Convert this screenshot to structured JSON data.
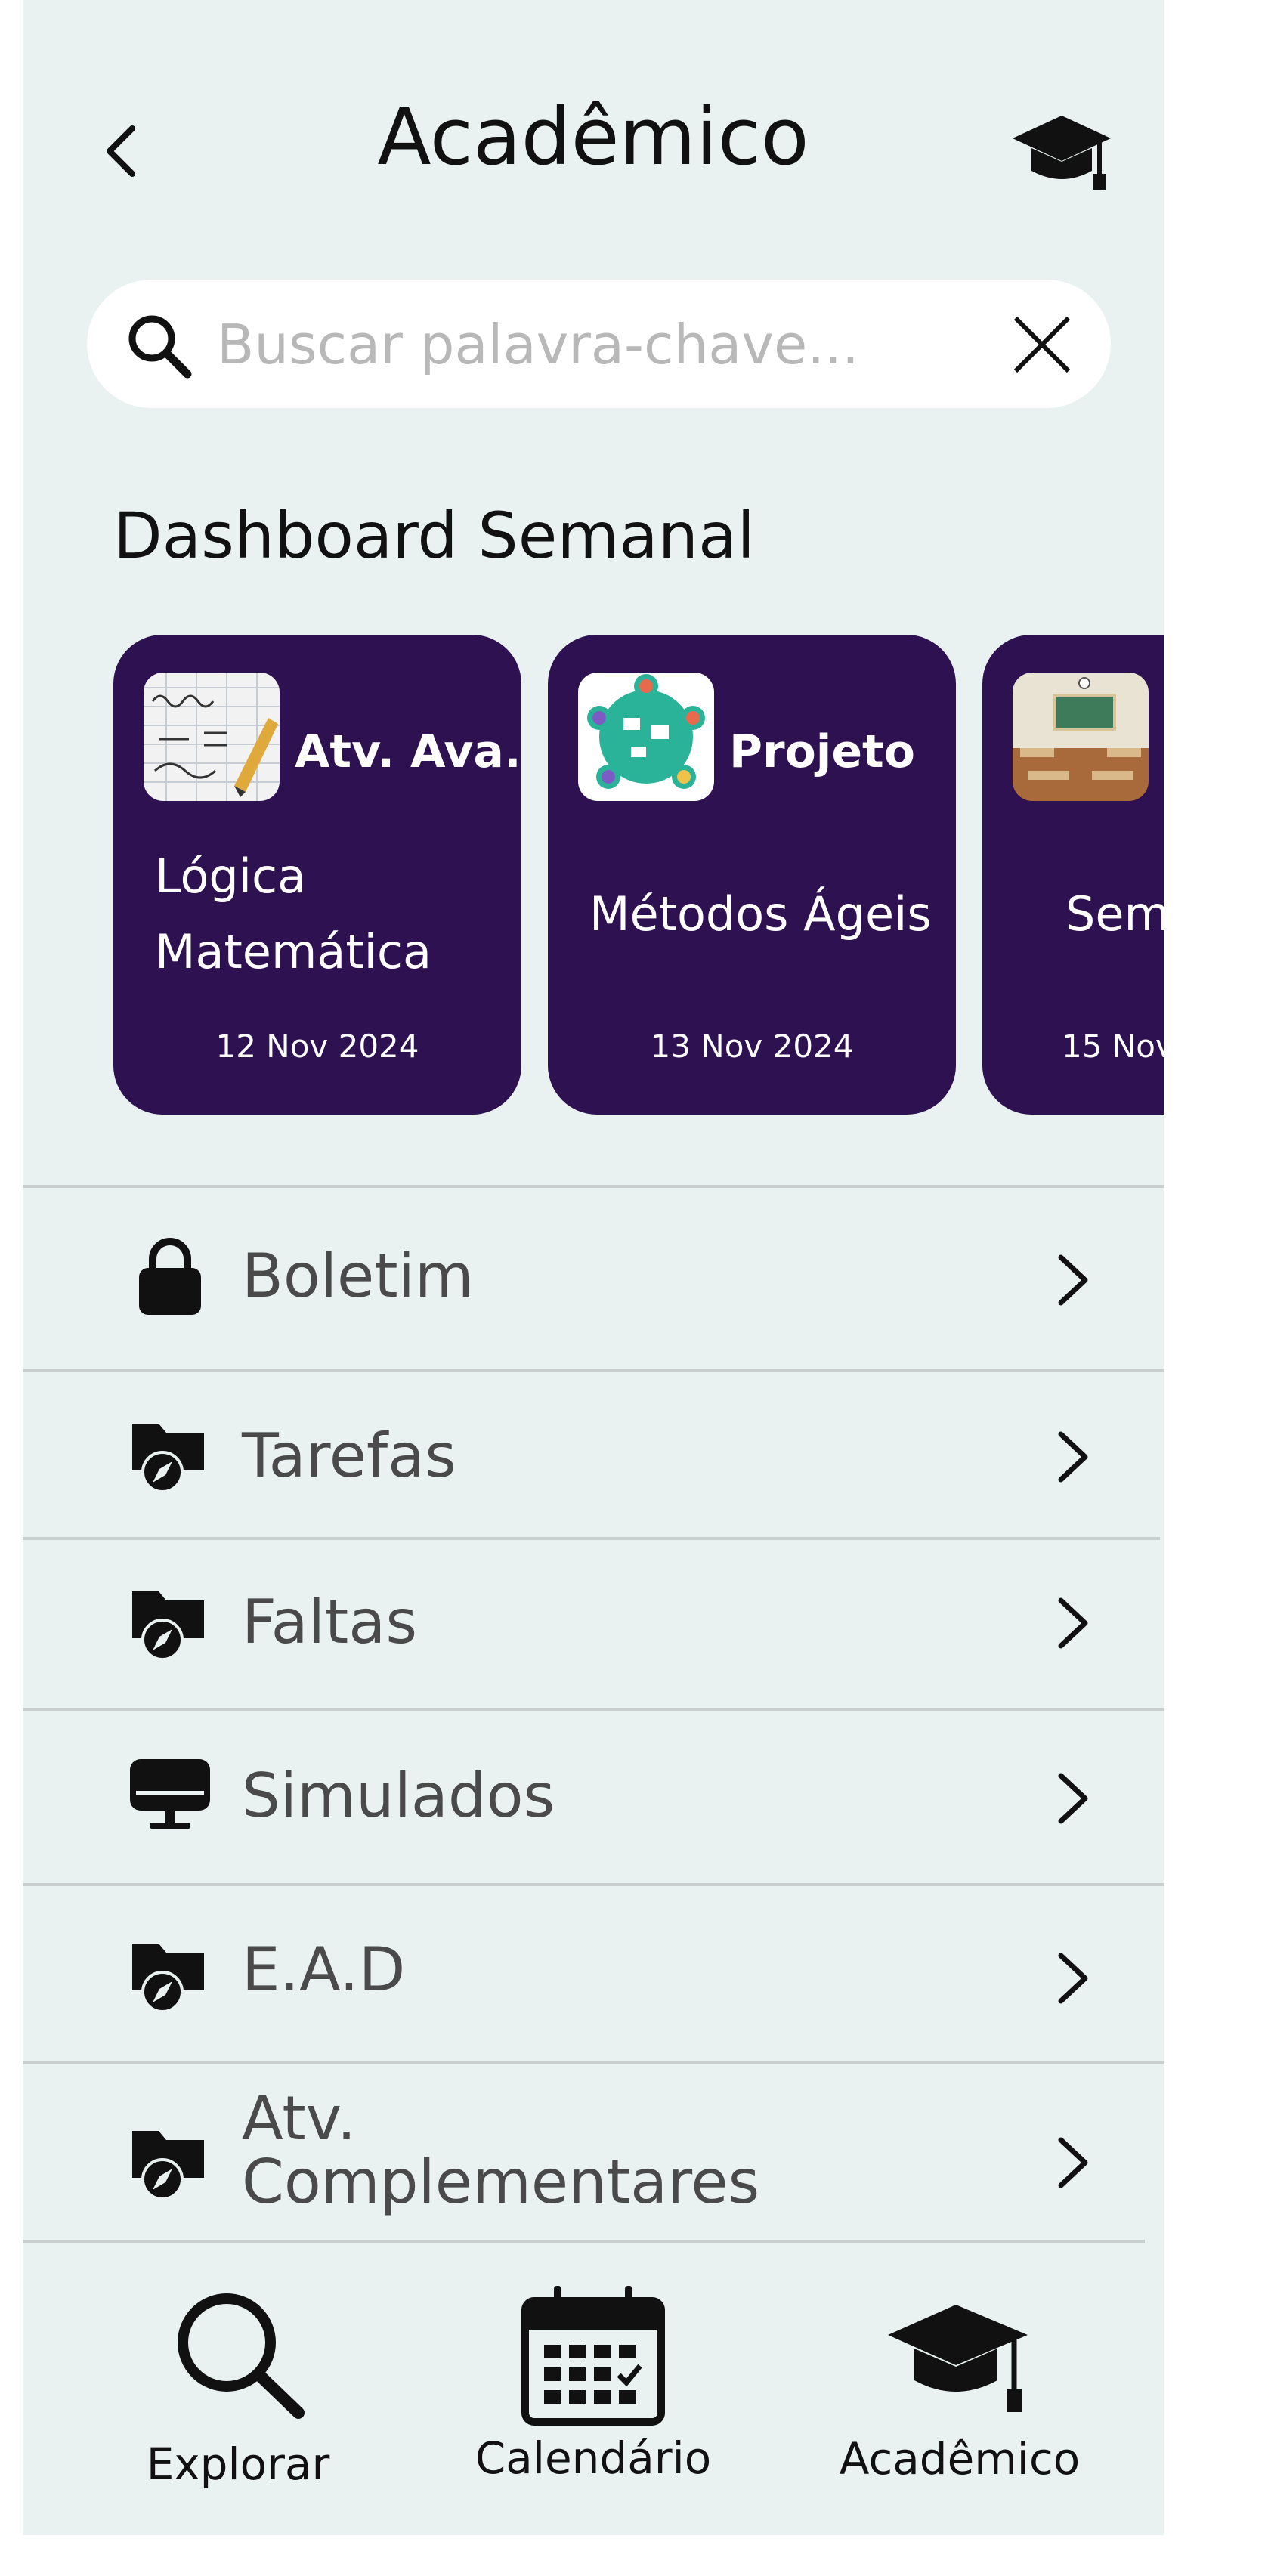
{
  "header": {
    "title": "Acadêmico"
  },
  "search": {
    "placeholder": "Buscar palavra-chave..."
  },
  "dashboard": {
    "title": "Dashboard Semanal",
    "cards": [
      {
        "category": "Atv. Ava.",
        "name": "Lógica Matemática",
        "date": "12 Nov 2024"
      },
      {
        "category": "Projeto",
        "name": "Métodos Ágeis",
        "date": "13 Nov 2024"
      },
      {
        "category": "",
        "name": "Sem",
        "date": "15 Nov"
      }
    ]
  },
  "menu": {
    "items": [
      {
        "label": "Boletim",
        "icon": "lock-icon"
      },
      {
        "label": "Tarefas",
        "icon": "folder-compass-icon"
      },
      {
        "label": "Faltas",
        "icon": "folder-compass-icon"
      },
      {
        "label": "Simulados",
        "icon": "monitor-icon"
      },
      {
        "label": "E.A.D",
        "icon": "folder-compass-icon"
      },
      {
        "label": "Atv. Complementares",
        "label_line1": "Atv.",
        "label_line2": "Complementares",
        "icon": "folder-compass-icon"
      }
    ]
  },
  "nav": {
    "items": [
      {
        "label": "Explorar",
        "icon": "search-icon"
      },
      {
        "label": "Calendário",
        "icon": "calendar-icon"
      },
      {
        "label": "Acadêmico",
        "icon": "graduation-cap-icon",
        "active": true
      }
    ]
  },
  "colors": {
    "background": "#e9f1f1",
    "card": "#2e1150",
    "text": "#111111",
    "muted": "#4a4a4a"
  }
}
